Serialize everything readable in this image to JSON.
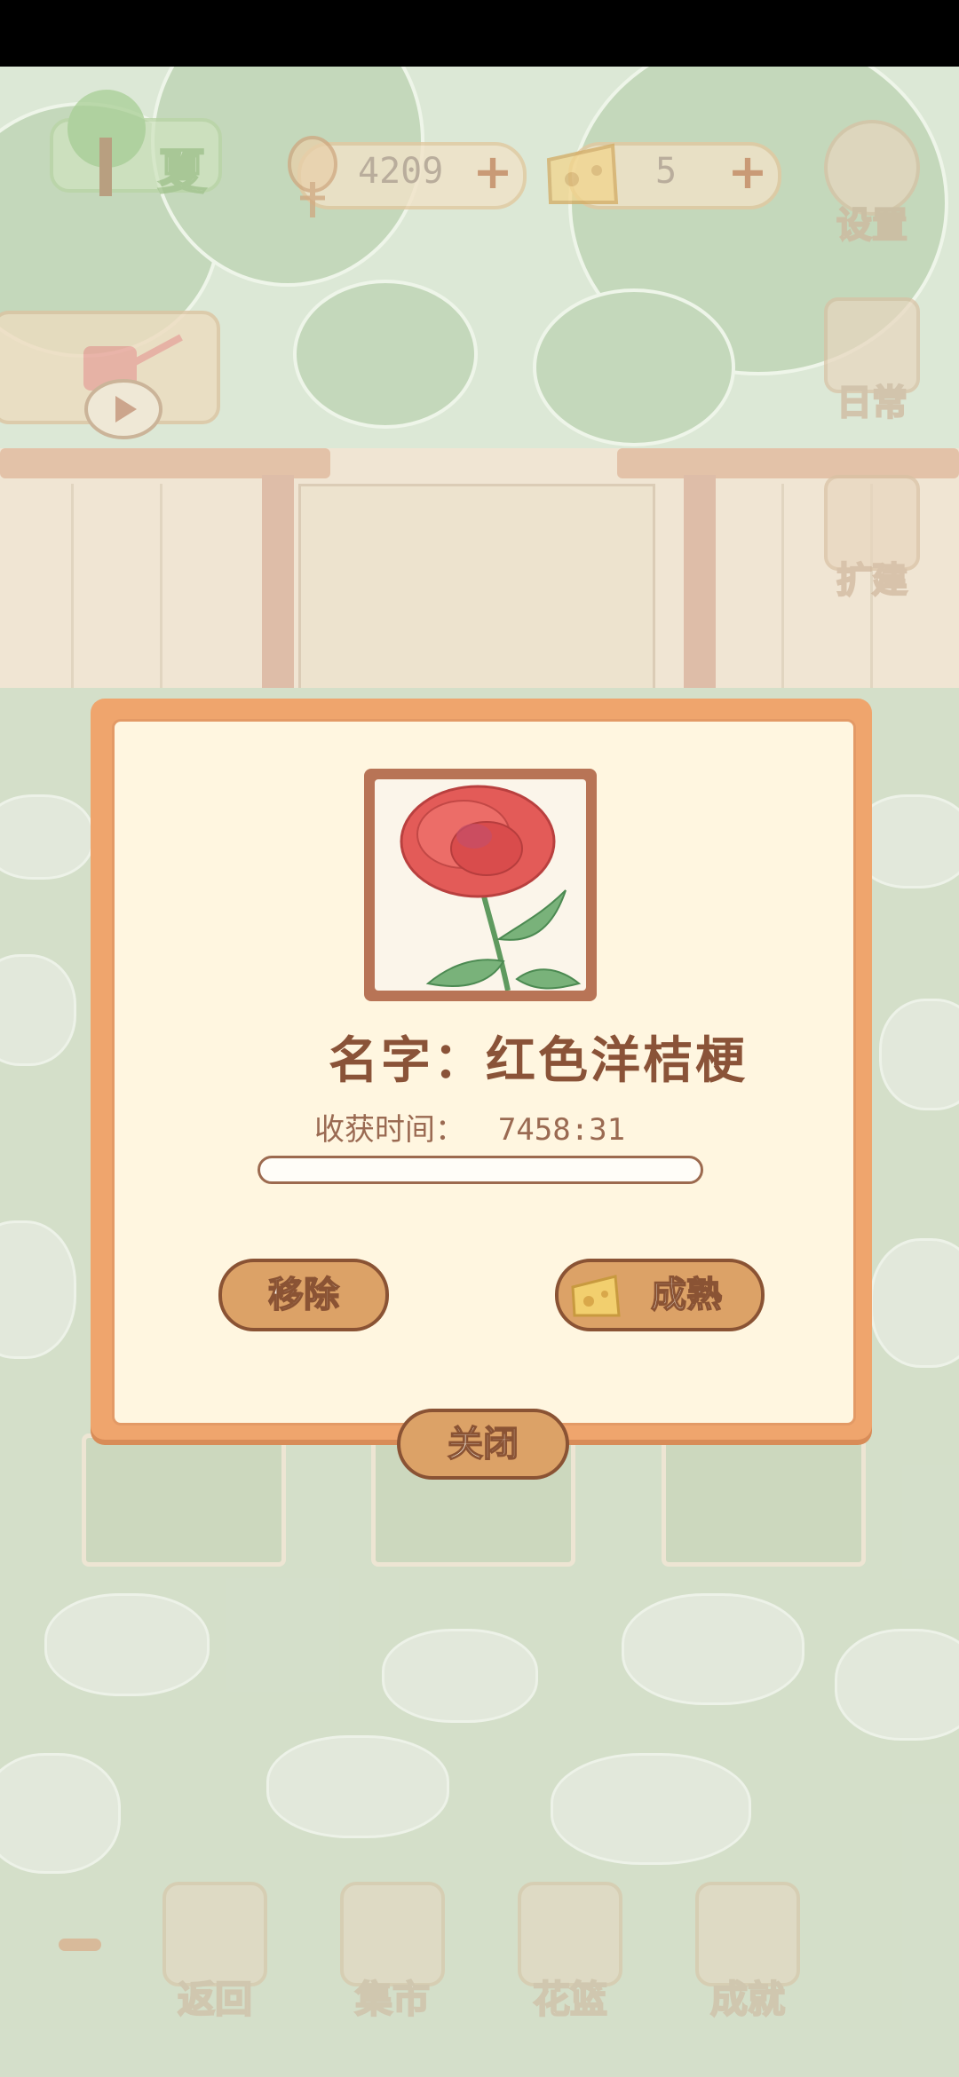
{
  "hud": {
    "season_label": "夏",
    "fish_count": "4209",
    "cheese_count": "5",
    "plus_symbol": "+",
    "settings_label": "设置",
    "daily_label": "日常",
    "expand_label": "扩建"
  },
  "dialog": {
    "name_text": "名字：红色洋桔梗",
    "harvest_label": "收获时间：",
    "harvest_value": "7458:31",
    "progress_percent": 0,
    "remove_label": "移除",
    "ripen_label": "成熟",
    "close_label": "关闭"
  },
  "bottom_nav": {
    "items": [
      {
        "label": "返回",
        "icon": "window-icon"
      },
      {
        "label": "集市",
        "icon": "market-stall-icon"
      },
      {
        "label": "花篮",
        "icon": "flower-basket-icon"
      },
      {
        "label": "成就",
        "icon": "trophy-icon"
      }
    ]
  },
  "colors": {
    "dialog_border": "#efa56d",
    "dialog_bg": "#fff6e0",
    "button_fill": "#dca267",
    "button_outline": "#8a5334",
    "text_brown": "#8a5338"
  }
}
